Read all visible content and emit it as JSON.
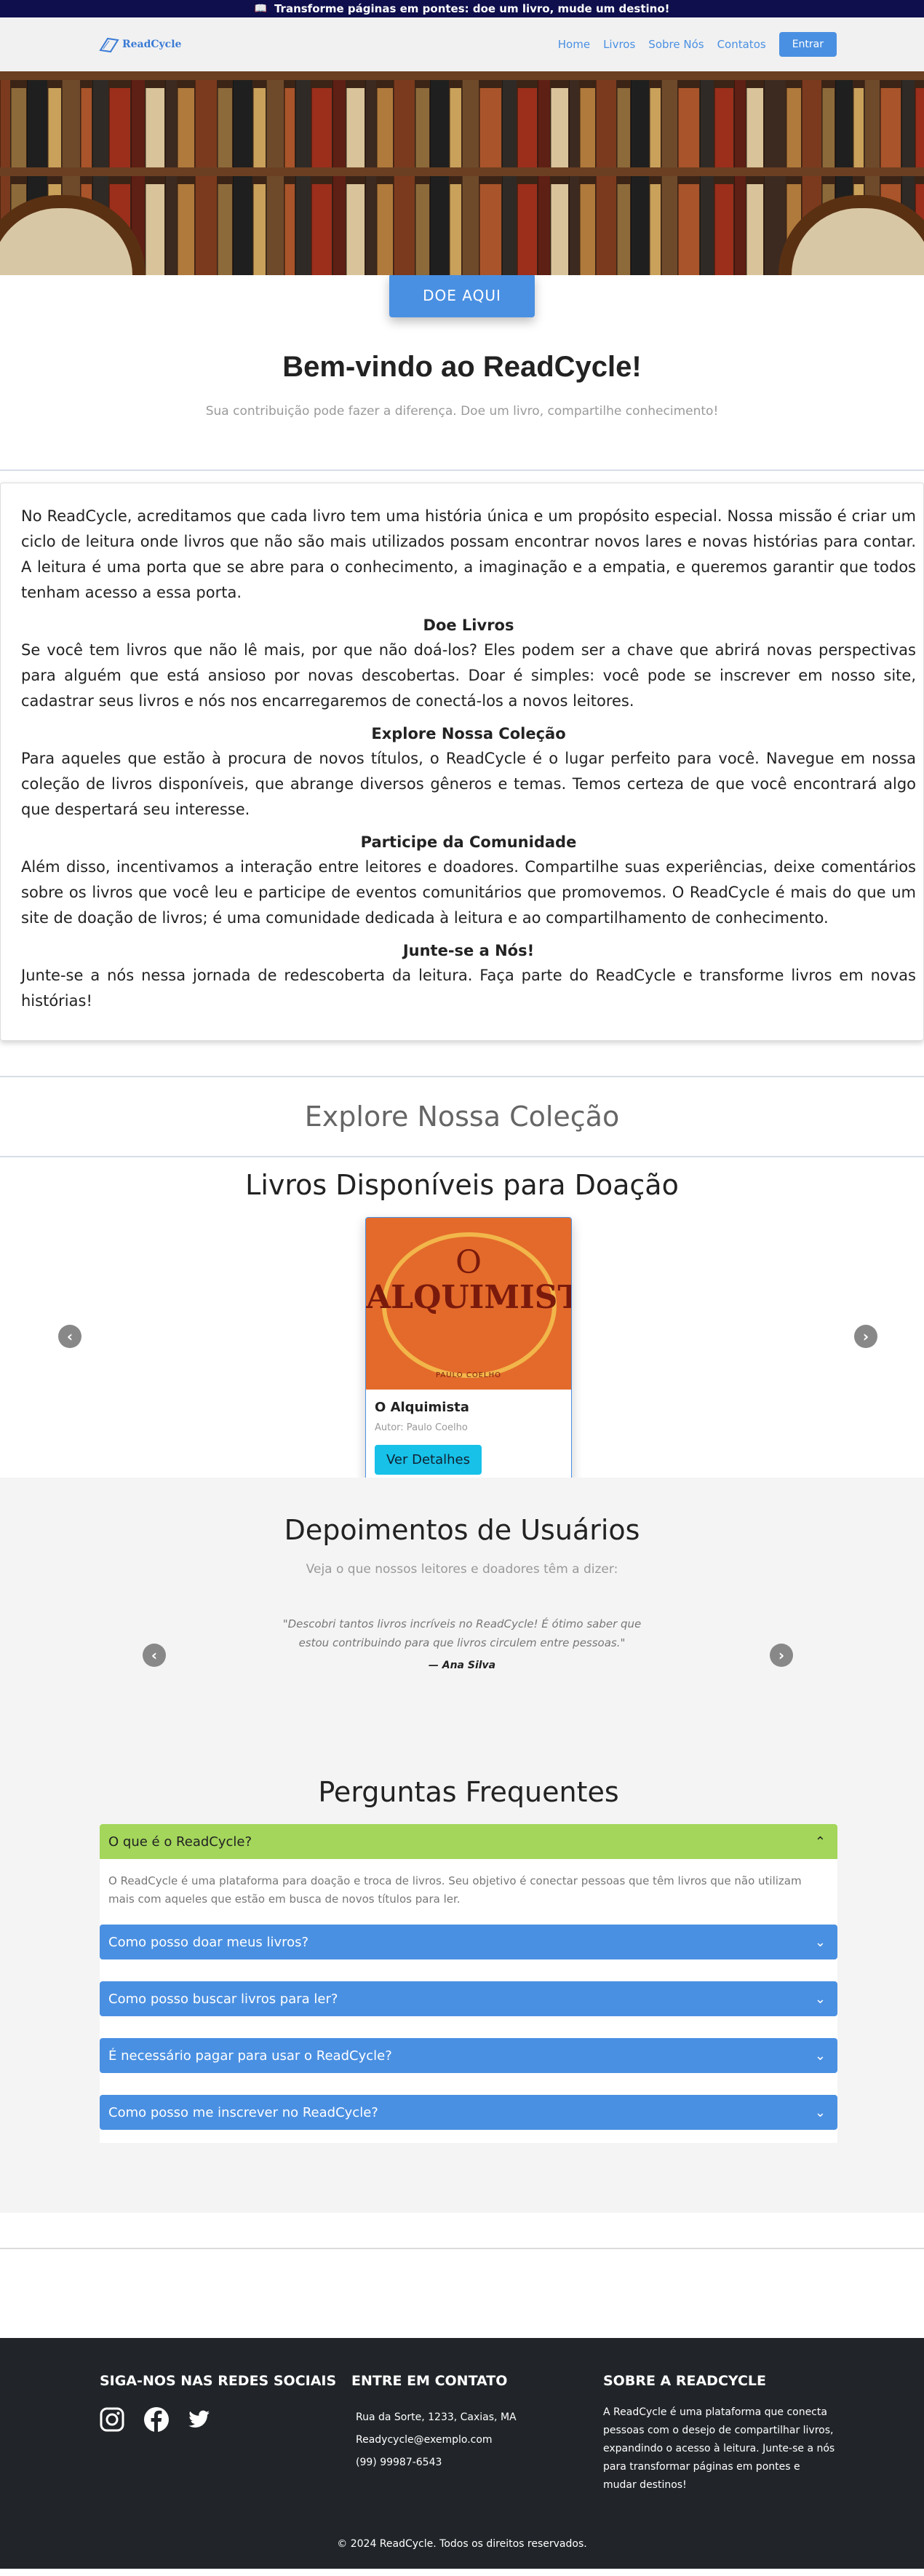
{
  "topbar": {
    "text": "Transforme páginas em pontes: doe um livro, mude um destino!"
  },
  "navbar": {
    "logo_text": "ReadCycle",
    "links": [
      "Home",
      "Livros",
      "Sobre Nós",
      "Contatos"
    ],
    "login_label": "Entrar"
  },
  "hero": {
    "donate_label": "DOE AQUI"
  },
  "welcome": {
    "title": "Bem-vindo ao ReadCycle!",
    "subtitle": "Sua contribuição pode fazer a diferença. Doe um livro, compartilhe conhecimento!"
  },
  "about": {
    "intro": "No ReadCycle, acreditamos que cada livro tem uma história única e um propósito especial. Nossa missão é criar um ciclo de leitura onde livros que não são mais utilizados possam encontrar novos lares e novas histórias para contar. A leitura é uma porta que se abre para o conhecimento, a imaginação e a empatia, e queremos garantir que todos tenham acesso a essa porta.",
    "sections": [
      {
        "heading": "Doe Livros",
        "text": "Se você tem livros que não lê mais, por que não doá-los? Eles podem ser a chave que abrirá novas perspectivas para alguém que está ansioso por novas descobertas. Doar é simples: você pode se inscrever em nosso site, cadastrar seus livros e nós nos encarregaremos de conectá-los a novos leitores."
      },
      {
        "heading": "Explore Nossa Coleção",
        "text": "Para aqueles que estão à procura de novos títulos, o ReadCycle é o lugar perfeito para você. Navegue em nossa coleção de livros disponíveis, que abrange diversos gêneros e temas. Temos certeza de que você encontrará algo que despertará seu interesse."
      },
      {
        "heading": "Participe da Comunidade",
        "text": "Além disso, incentivamos a interação entre leitores e doadores. Compartilhe suas experiências, deixe comentários sobre os livros que você leu e participe de eventos comunitários que promovemos. O ReadCycle é mais do que um site de doação de livros; é uma comunidade dedicada à leitura e ao compartilhamento de conhecimento."
      },
      {
        "heading": "Junte-se a Nós!",
        "text": "Junte-se a nós nessa jornada de redescoberta da leitura. Faça parte do ReadCycle e transforme livros em novas histórias!"
      }
    ]
  },
  "explore": {
    "title": "Explore Nossa Coleção"
  },
  "books": {
    "title": "Livros Disponíveis para Doação",
    "card": {
      "cover_line1": "O",
      "cover_line2": "ALQUIMISTA",
      "cover_author": "PAULO COELHO",
      "title": "O Alquimista",
      "author": "Autor: Paulo Coelho",
      "details_label": "Ver Detalhes"
    }
  },
  "testimonials": {
    "title": "Depoimentos de Usuários",
    "subtitle": "Veja o que nossos leitores e doadores têm a dizer:",
    "quote": "\"Descobri tantos livros incríveis no ReadCycle! É ótimo saber que estou contribuindo para que livros circulem entre pessoas.\"",
    "author": "— Ana Silva"
  },
  "faq": {
    "title": "Perguntas Frequentes",
    "items": [
      {
        "question": "O que é o ReadCycle?",
        "answer": "O ReadCycle é uma plataforma para doação e troca de livros. Seu objetivo é conectar pessoas que têm livros que não utilizam mais com aqueles que estão em busca de novos títulos para ler."
      },
      {
        "question": "Como posso doar meus livros?"
      },
      {
        "question": "Como posso buscar livros para ler?"
      },
      {
        "question": "É necessário pagar para usar o ReadCycle?"
      },
      {
        "question": "Como posso me inscrever no ReadCycle?"
      }
    ]
  },
  "footer": {
    "social_title": "SIGA-NOS NAS REDES SOCIAIS",
    "social_icons": [
      "instagram-icon",
      "facebook-icon",
      "twitter-icon"
    ],
    "contact_title": "ENTRE EM CONTATO",
    "address": "Rua da Sorte, 1233, Caxias, MA",
    "email": "Readycycle@exemplo.com",
    "phone": "(99) 99987-6543",
    "about_title": "SOBRE A READCYCLE",
    "about_text": "A ReadCycle é uma plataforma que conecta pessoas com o desejo de compartilhar livros, expandindo o acesso à leitura. Junte-se a nós para transformar páginas em pontes e mudar destinos!",
    "copyright": "© 2024 ReadCycle. Todos os direitos reservados."
  },
  "colors": {
    "topbar": "#0f0f4d",
    "accent": "#4a90e2",
    "faq_active": "#a3d65b",
    "details_button": "#17c1e8",
    "footer": "#212529"
  }
}
